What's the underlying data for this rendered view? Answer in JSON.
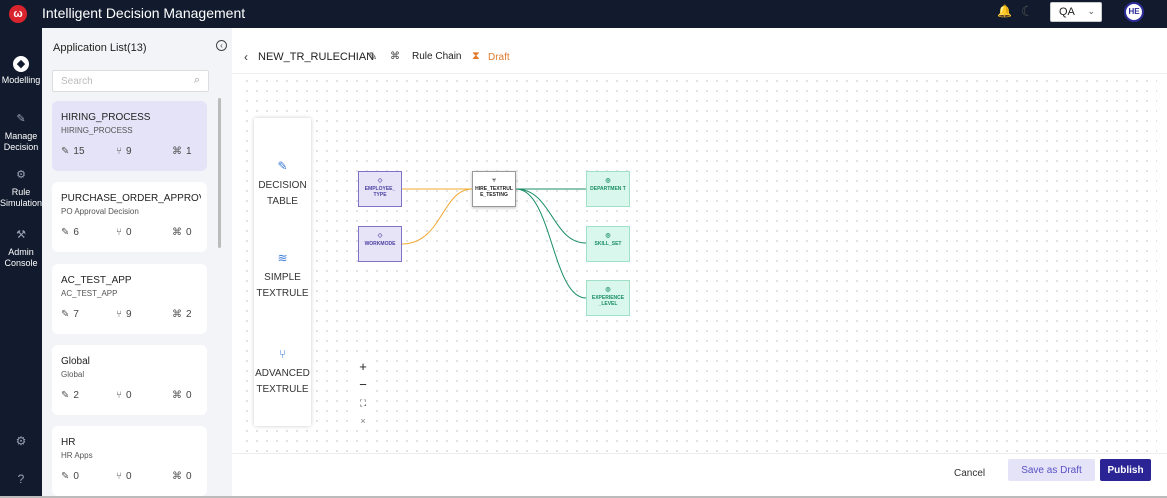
{
  "topbar": {
    "logo_text": "ω",
    "title": "Intelligent Decision Management",
    "env": "QA",
    "avatar": "HE"
  },
  "nav": [
    {
      "label": "Modelling",
      "icon": "cube-icon"
    },
    {
      "label": "Manage Decision",
      "icon": "edit-icon"
    },
    {
      "label": "Rule Simulation",
      "icon": "simulation-icon"
    },
    {
      "label": "Admin Console",
      "icon": "admin-icon"
    }
  ],
  "applist": {
    "title": "Application List(13)",
    "search_placeholder": "Search",
    "apps": [
      {
        "name": "HIRING_PROCESS",
        "sub": "HIRING_PROCESS",
        "tables": "15",
        "flows": "9",
        "chains": "1"
      },
      {
        "name": "PURCHASE_ORDER_APPROV...",
        "sub": "PO Approval Decision",
        "tables": "6",
        "flows": "0",
        "chains": "0"
      },
      {
        "name": "AC_TEST_APP",
        "sub": "AC_TEST_APP",
        "tables": "7",
        "flows": "9",
        "chains": "2"
      },
      {
        "name": "Global",
        "sub": "Global",
        "tables": "2",
        "flows": "0",
        "chains": "0"
      },
      {
        "name": "HR",
        "sub": "HR Apps",
        "tables": "0",
        "flows": "0",
        "chains": "0"
      }
    ]
  },
  "header": {
    "name": "NEW_TR_RULECHIAN",
    "type": "Rule Chain",
    "status": "Draft"
  },
  "palette": [
    {
      "label1": "DECISION",
      "label2": "TABLE"
    },
    {
      "label1": "SIMPLE",
      "label2": "TEXTRULE"
    },
    {
      "label1": "ADVANCED",
      "label2": "TEXTRULE"
    }
  ],
  "nodes": {
    "employee_type": "EMPLOYEE_ TYPE",
    "workmode": "WORKMODE",
    "hire": "HIRE_TEXTRUL E_TESTING",
    "department": "DEPARTMEN T",
    "skill_set": "SKILL_SET",
    "experience": "EXPERIENCE _LEVEL"
  },
  "footer": {
    "cancel": "Cancel",
    "save_draft": "Save as Draft",
    "publish": "Publish"
  },
  "colors": {
    "topbar": "#111b2d",
    "accent": "#2a2495",
    "draft": "#e07a2e",
    "edge_in": "#f0a830",
    "edge_out": "#1a8e65"
  }
}
